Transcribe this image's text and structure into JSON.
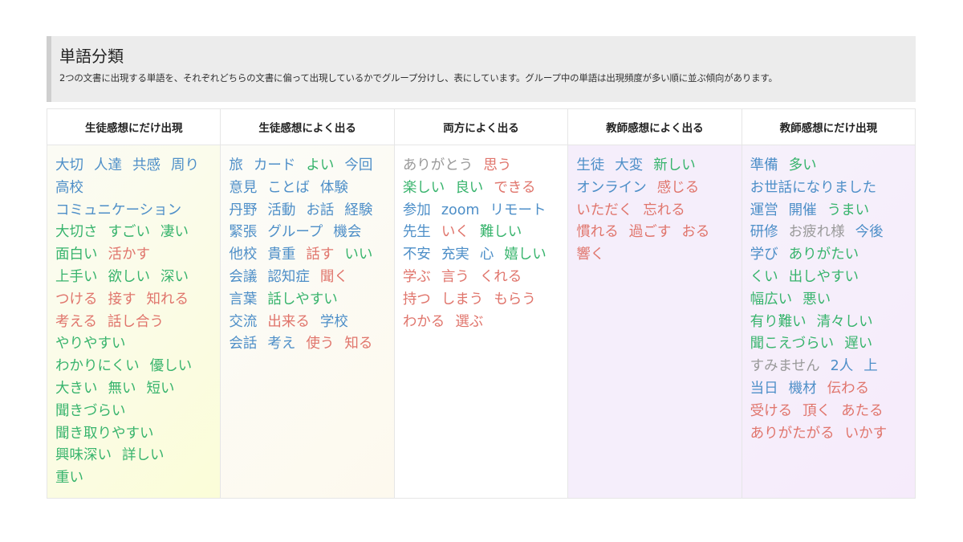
{
  "header": {
    "title": "単語分類",
    "subtitle": "2つの文書に出現する単語を、それぞれどちらの文書に偏って出現しているかでグループ分けし、表にしています。グループ中の単語は出現頻度が多い順に並ぶ傾向があります。"
  },
  "colors": {
    "blue": "#4e8fc8",
    "green": "#38b46d",
    "red": "#e0756c",
    "gray": "#9a9a9a"
  },
  "columns": [
    {
      "heading": "生徒感想にだけ出現",
      "lines": [
        [
          [
            "大切",
            "blue"
          ],
          [
            "人達",
            "blue"
          ],
          [
            "共感",
            "blue"
          ],
          [
            "周り",
            "blue"
          ]
        ],
        [
          [
            "高校",
            "blue"
          ]
        ],
        [
          [
            "コミュニケーション",
            "blue"
          ]
        ],
        [
          [
            "大切さ",
            "green"
          ],
          [
            "すごい",
            "green"
          ],
          [
            "凄い",
            "green"
          ]
        ],
        [
          [
            "面白い",
            "green"
          ],
          [
            "活かす",
            "red"
          ]
        ],
        [
          [
            "上手い",
            "green"
          ],
          [
            "欲しい",
            "green"
          ],
          [
            "深い",
            "green"
          ]
        ],
        [
          [
            "つける",
            "red"
          ],
          [
            "接す",
            "red"
          ],
          [
            "知れる",
            "red"
          ]
        ],
        [
          [
            "考える",
            "red"
          ],
          [
            "話し合う",
            "red"
          ]
        ],
        [
          [
            "やりやすい",
            "green"
          ]
        ],
        [
          [
            "わかりにくい",
            "green"
          ],
          [
            "優しい",
            "green"
          ]
        ],
        [
          [
            "大きい",
            "green"
          ],
          [
            "無い",
            "green"
          ],
          [
            "短い",
            "green"
          ]
        ],
        [
          [
            "聞きづらい",
            "green"
          ]
        ],
        [
          [
            "聞き取りやすい",
            "green"
          ]
        ],
        [
          [
            "興味深い",
            "green"
          ],
          [
            "詳しい",
            "green"
          ]
        ],
        [
          [
            "重い",
            "green"
          ]
        ]
      ]
    },
    {
      "heading": "生徒感想によく出る",
      "lines": [
        [
          [
            "旅",
            "blue"
          ],
          [
            "カード",
            "blue"
          ],
          [
            "よい",
            "green"
          ],
          [
            "今回",
            "blue"
          ]
        ],
        [
          [
            "意見",
            "blue"
          ],
          [
            "ことば",
            "blue"
          ],
          [
            "体験",
            "blue"
          ]
        ],
        [
          [
            "丹野",
            "blue"
          ],
          [
            "活動",
            "blue"
          ],
          [
            "お話",
            "blue"
          ],
          [
            "経験",
            "blue"
          ]
        ],
        [
          [
            "緊張",
            "blue"
          ],
          [
            "グループ",
            "blue"
          ],
          [
            "機会",
            "blue"
          ]
        ],
        [
          [
            "他校",
            "blue"
          ],
          [
            "貴重",
            "blue"
          ],
          [
            "話す",
            "red"
          ],
          [
            "いい",
            "green"
          ]
        ],
        [
          [
            "会議",
            "blue"
          ],
          [
            "認知症",
            "blue"
          ],
          [
            "聞く",
            "red"
          ]
        ],
        [
          [
            "言葉",
            "blue"
          ],
          [
            "話しやすい",
            "green"
          ]
        ],
        [
          [
            "交流",
            "blue"
          ],
          [
            "出来る",
            "red"
          ],
          [
            "学校",
            "blue"
          ]
        ],
        [
          [
            "会話",
            "blue"
          ],
          [
            "考え",
            "blue"
          ],
          [
            "使う",
            "red"
          ],
          [
            "知る",
            "red"
          ]
        ]
      ]
    },
    {
      "heading": "両方によく出る",
      "lines": [
        [
          [
            "ありがとう",
            "gray"
          ],
          [
            "思う",
            "red"
          ]
        ],
        [
          [
            "楽しい",
            "green"
          ],
          [
            "良い",
            "green"
          ],
          [
            "できる",
            "red"
          ]
        ],
        [
          [
            "参加",
            "blue"
          ],
          [
            "zoom",
            "blue"
          ],
          [
            "リモート",
            "blue"
          ]
        ],
        [
          [
            "先生",
            "blue"
          ],
          [
            "いく",
            "red"
          ],
          [
            "難しい",
            "green"
          ]
        ],
        [
          [
            "不安",
            "blue"
          ],
          [
            "充実",
            "blue"
          ],
          [
            "心",
            "blue"
          ],
          [
            "嬉しい",
            "green"
          ]
        ],
        [
          [
            "学ぶ",
            "red"
          ],
          [
            "言う",
            "red"
          ],
          [
            "くれる",
            "red"
          ]
        ],
        [
          [
            "持つ",
            "red"
          ],
          [
            "しまう",
            "red"
          ],
          [
            "もらう",
            "red"
          ]
        ],
        [
          [
            "わかる",
            "red"
          ],
          [
            "選ぶ",
            "red"
          ]
        ]
      ]
    },
    {
      "heading": "教師感想によく出る",
      "lines": [
        [
          [
            "生徒",
            "blue"
          ],
          [
            "大変",
            "blue"
          ],
          [
            "新しい",
            "green"
          ]
        ],
        [
          [
            "オンライン",
            "blue"
          ],
          [
            "感じる",
            "red"
          ]
        ],
        [
          [
            "いただく",
            "red"
          ],
          [
            "忘れる",
            "red"
          ]
        ],
        [
          [
            "慣れる",
            "red"
          ],
          [
            "過ごす",
            "red"
          ],
          [
            "おる",
            "red"
          ]
        ],
        [
          [
            "響く",
            "red"
          ]
        ]
      ]
    },
    {
      "heading": "教師感想にだけ出現",
      "lines": [
        [
          [
            "準備",
            "blue"
          ],
          [
            "多い",
            "green"
          ]
        ],
        [
          [
            "お世話になりました",
            "blue"
          ]
        ],
        [
          [
            "運営",
            "blue"
          ],
          [
            "開催",
            "blue"
          ],
          [
            "うまい",
            "green"
          ]
        ],
        [
          [
            "研修",
            "blue"
          ],
          [
            "お疲れ様",
            "gray"
          ],
          [
            "今後",
            "blue"
          ]
        ],
        [
          [
            "学び",
            "blue"
          ],
          [
            "ありがたい",
            "green"
          ]
        ],
        [
          [
            "くい",
            "green"
          ],
          [
            "出しやすい",
            "green"
          ]
        ],
        [
          [
            "幅広い",
            "green"
          ],
          [
            "悪い",
            "green"
          ]
        ],
        [
          [
            "有り難い",
            "green"
          ],
          [
            "清々しい",
            "green"
          ]
        ],
        [
          [
            "聞こえづらい",
            "green"
          ],
          [
            "遅い",
            "green"
          ]
        ],
        [
          [
            "すみません",
            "gray"
          ],
          [
            "2人",
            "blue"
          ],
          [
            "上",
            "blue"
          ]
        ],
        [
          [
            "当日",
            "blue"
          ],
          [
            "機材",
            "blue"
          ],
          [
            "伝わる",
            "red"
          ]
        ],
        [
          [
            "受ける",
            "red"
          ],
          [
            "頂く",
            "red"
          ],
          [
            "あたる",
            "red"
          ]
        ],
        [
          [
            "ありがたがる",
            "red"
          ],
          [
            "いかす",
            "red"
          ]
        ]
      ]
    }
  ]
}
